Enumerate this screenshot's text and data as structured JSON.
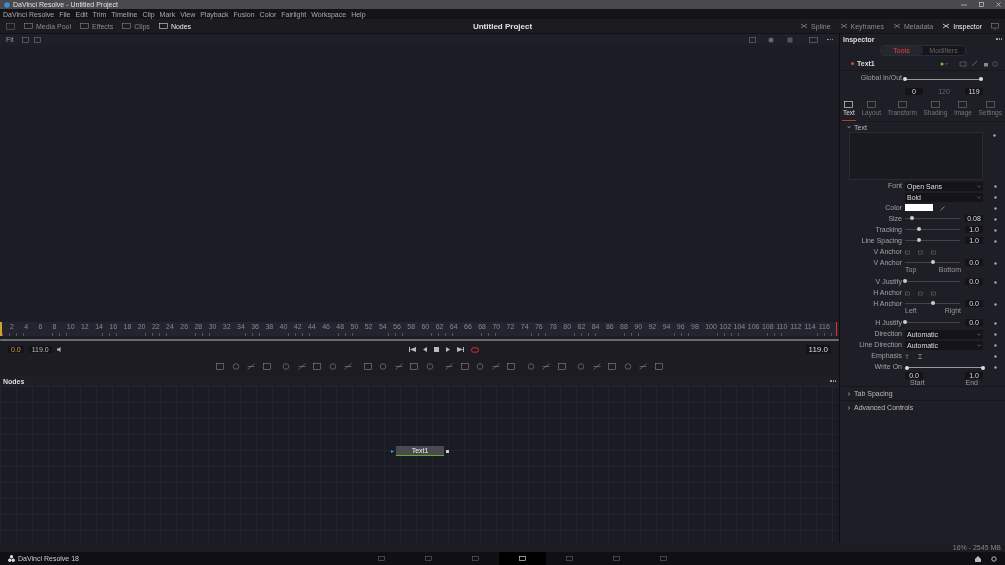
{
  "window": {
    "title": "DaVinci Resolve - Untitled Project"
  },
  "menu": [
    "DaVinci Resolve",
    "File",
    "Edit",
    "Trim",
    "Timeline",
    "Clip",
    "Mark",
    "View",
    "Playback",
    "Fusion",
    "Color",
    "Fairlight",
    "Workspace",
    "Help"
  ],
  "toolbar": {
    "left": [
      {
        "label": "Media Pool",
        "selected": false
      },
      {
        "label": "Effects",
        "selected": false
      },
      {
        "label": "Clips",
        "selected": false
      },
      {
        "label": "Nodes",
        "selected": true
      }
    ],
    "project": "Untitled Project",
    "right": [
      {
        "label": "Spline",
        "selected": false
      },
      {
        "label": "Keyframes",
        "selected": false
      },
      {
        "label": "Metadata",
        "selected": false
      },
      {
        "label": "Inspector",
        "selected": true
      }
    ]
  },
  "viewer": {
    "zoom": "Fit"
  },
  "ruler": [
    "2",
    "4",
    "6",
    "8",
    "10",
    "12",
    "14",
    "16",
    "18",
    "20",
    "22",
    "24",
    "26",
    "28",
    "30",
    "32",
    "34",
    "36",
    "38",
    "40",
    "42",
    "44",
    "46",
    "48",
    "50",
    "52",
    "54",
    "56",
    "58",
    "60",
    "62",
    "64",
    "66",
    "68",
    "70",
    "72",
    "74",
    "76",
    "78",
    "80",
    "82",
    "84",
    "86",
    "88",
    "90",
    "92",
    "94",
    "96",
    "98",
    "100",
    "102",
    "104",
    "106",
    "108",
    "110",
    "112",
    "114",
    "116"
  ],
  "transport": {
    "start": "0.0",
    "end": "119.0",
    "loop": true,
    "timecode": "119.0"
  },
  "nodes": {
    "title": "Nodes",
    "node": "Text1"
  },
  "inspector": {
    "title": "Inspector",
    "tabs": [
      {
        "label": "Tools",
        "selected": true
      },
      {
        "label": "Modifiers",
        "selected": false
      }
    ],
    "tool": "Text1",
    "global": {
      "label": "Global In/Out",
      "start": "0",
      "middle": "120",
      "end": "119",
      "level": 1
    },
    "subtabs": [
      {
        "label": "Text",
        "selected": true
      },
      {
        "label": "Layout",
        "selected": false
      },
      {
        "label": "Transform",
        "selected": false
      },
      {
        "label": "Shading",
        "selected": false
      },
      {
        "label": "Image",
        "selected": false
      },
      {
        "label": "Settings",
        "selected": false
      }
    ],
    "section": {
      "label": "Text",
      "expanded": true
    },
    "rows": [
      {
        "kind": "dropdown",
        "label": "Font",
        "value": "Open Sans"
      },
      {
        "kind": "dropdown",
        "value": "Bold"
      },
      {
        "kind": "color",
        "label": "Color"
      },
      {
        "kind": "slider",
        "label": "Size",
        "level": 0.12,
        "value": "0.08"
      },
      {
        "kind": "slider",
        "label": "Tracking",
        "level": 0.25,
        "value": "1.0"
      },
      {
        "kind": "slider",
        "label": "Line Spacing",
        "level": 0.25,
        "value": "1.0"
      },
      {
        "kind": "anchor",
        "label": "V Anchor"
      },
      {
        "kind": "slider",
        "label": "V Anchor",
        "level": 0.5,
        "value": "0.0",
        "ends": [
          "Top",
          "Bottom"
        ]
      },
      {
        "kind": "slider",
        "label": "V Justify",
        "level": 0,
        "value": "0.0"
      },
      {
        "kind": "anchor",
        "label": "H Anchor"
      },
      {
        "kind": "slider",
        "label": "H Anchor",
        "level": 0.5,
        "value": "0.0",
        "ends": [
          "Left",
          "Right"
        ]
      },
      {
        "kind": "slider",
        "label": "H Justify",
        "level": 0,
        "value": "0.0"
      },
      {
        "kind": "dropdown",
        "label": "Direction",
        "value": "Automatic"
      },
      {
        "kind": "dropdown",
        "label": "Line Direction",
        "value": "Automatic"
      },
      {
        "kind": "emphasis",
        "label": "Emphasis"
      },
      {
        "kind": "range",
        "label": "Write On",
        "level": 1,
        "start": "0.0",
        "end": "1.0",
        "ends": [
          "Start",
          "End"
        ]
      }
    ],
    "sections": [
      {
        "label": "Tab Spacing",
        "expanded": false
      },
      {
        "label": "Advanced Controls",
        "expanded": false
      }
    ]
  },
  "status": "16% - 2545 MB",
  "app": "DaVinci Resolve 18",
  "pages": [
    {
      "selected": false
    },
    {
      "selected": false
    },
    {
      "selected": false
    },
    {
      "selected": true
    },
    {
      "selected": false
    },
    {
      "selected": false
    },
    {
      "selected": false
    }
  ]
}
